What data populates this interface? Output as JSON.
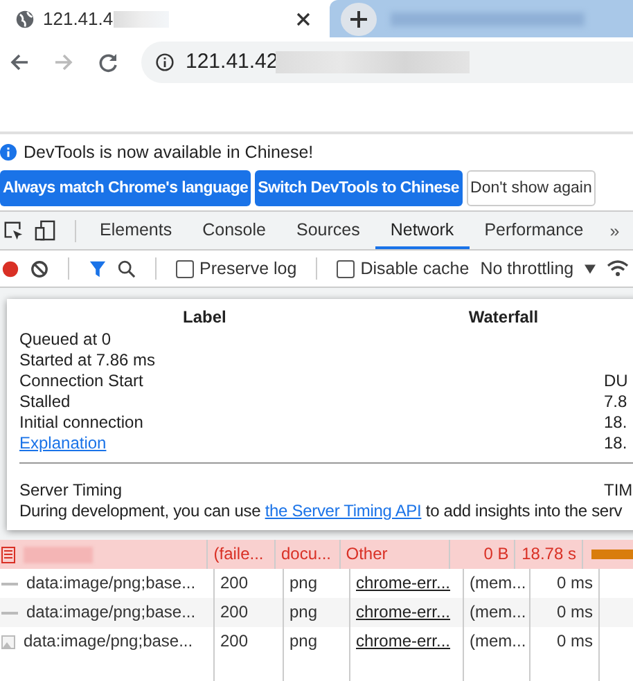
{
  "browser": {
    "tab": {
      "title": "121.41.4"
    },
    "url": "121.41.42"
  },
  "infobar": {
    "message": "DevTools is now available in Chinese!",
    "buttons": [
      {
        "label": "Always match Chrome's language",
        "kind": "primary"
      },
      {
        "label": "Switch DevTools to Chinese",
        "kind": "primary"
      },
      {
        "label": "Don't show again",
        "kind": "secondary"
      }
    ]
  },
  "devtools": {
    "tabs": [
      {
        "label": "Elements",
        "selected": false
      },
      {
        "label": "Console",
        "selected": false
      },
      {
        "label": "Sources",
        "selected": false
      },
      {
        "label": "Network",
        "selected": true
      },
      {
        "label": "Performance",
        "selected": false
      }
    ],
    "more": "»",
    "toolbar": {
      "checkboxes": [
        {
          "label": "Preserve log",
          "checked": false
        },
        {
          "label": "Disable cache",
          "checked": false
        }
      ],
      "throttling": "No throttling"
    }
  },
  "popup": {
    "headers": [
      "Label",
      "Waterfall"
    ],
    "rows": [
      {
        "label": "Queued at 0",
        "kind": "text"
      },
      {
        "label": "Started at 7.86 ms",
        "kind": "text"
      },
      {
        "label": "Connection Start",
        "kind": "text",
        "value": "DU"
      },
      {
        "label": "Stalled",
        "kind": "text",
        "value": "7.8"
      },
      {
        "label": "Initial connection",
        "kind": "text",
        "value": "18."
      },
      {
        "label": "Explanation",
        "kind": "link",
        "value": "18."
      }
    ],
    "server_timing": {
      "title": "Server Timing",
      "value": "TIM",
      "before": "During development, you can use ",
      "link": "the Server Timing API",
      "after": " to add insights into the serv"
    }
  },
  "requests": [
    {
      "kind": "document",
      "failed": true,
      "status": "(faile...",
      "type": "docu...",
      "initiator": "Other",
      "initiator_link": false,
      "size": "0 B",
      "time": "18.78 s",
      "waterfall_bar": true
    },
    {
      "kind": "line",
      "failed": false,
      "name": "data:image/png;base...",
      "status": "200",
      "type": "png",
      "initiator": "chrome-err...",
      "initiator_link": true,
      "size": "(mem...",
      "time": "0 ms",
      "waterfall_bar": false
    },
    {
      "kind": "line",
      "failed": false,
      "name": "data:image/png;base...",
      "status": "200",
      "type": "png",
      "initiator": "chrome-err...",
      "initiator_link": true,
      "size": "(mem...",
      "time": "0 ms",
      "waterfall_bar": false
    },
    {
      "kind": "image",
      "failed": false,
      "name": "data:image/png;base...",
      "status": "200",
      "type": "png",
      "initiator": "chrome-err...",
      "initiator_link": true,
      "size": "(mem...",
      "time": "0 ms",
      "waterfall_bar": false
    }
  ]
}
